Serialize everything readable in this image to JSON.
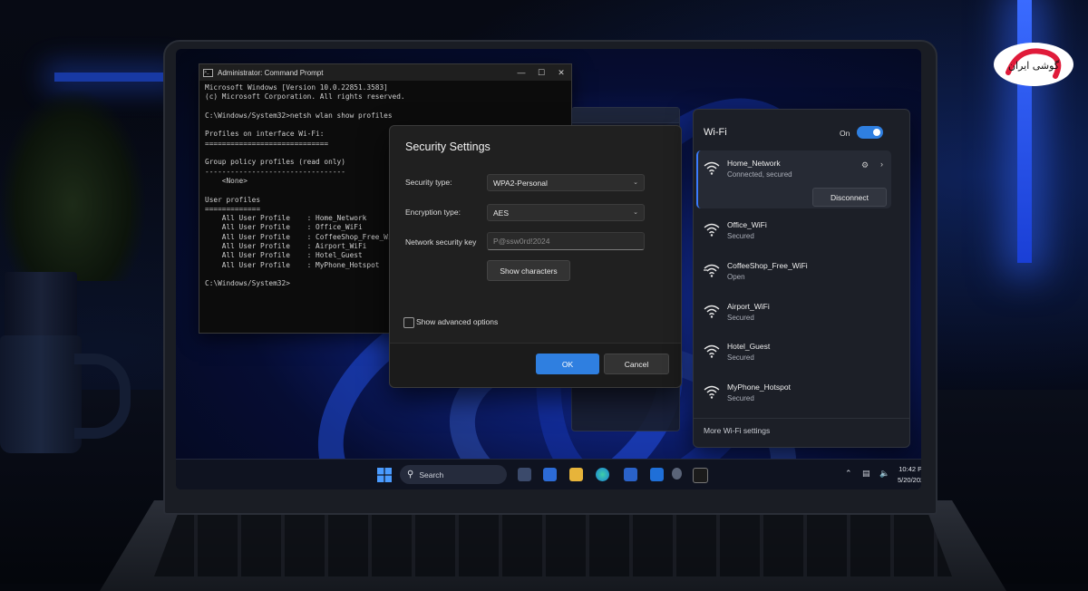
{
  "cmd": {
    "title": "Administrator: Command Prompt",
    "controls": {
      "minimize": "—",
      "maximize": "☐",
      "close": "✕"
    },
    "output": "Microsoft Windows [Version 10.0.22851.3583]\n(c) Microsoft Corporation. All rights reserved.\n\nC:\\Windows/System32>netsh wlan show profiles\n\nProfiles on interface Wi-Fi:\n=============================\n\nGroup policy profiles (read only)\n---------------------------------\n    <None>\n\nUser profiles\n=============\n    All User Profile    : Home_Network\n    All User Profile    : Office_WiFi\n    All User Profile    : CoffeeShop_Free_WiFi\n    All User Profile    : Airport_WiFi\n    All User Profile    : Hotel_Guest\n    All User Profile    : MyPhone_Hotspot\n\nC:\\Windows/System32>"
  },
  "dialog": {
    "title": "Security Settings",
    "security_type_label": "Security type:",
    "security_type_value": "WPA2-Personal",
    "encryption_type_label": "Encryption type:",
    "encryption_type_value": "AES",
    "key_label": "Network security key",
    "key_value": "P@ssw0rd!2024",
    "show_characters": "Show characters",
    "show_advanced": "Show advanced options",
    "ok": "OK",
    "cancel": "Cancel"
  },
  "wifi": {
    "title": "Wi-Fi",
    "toggle_label": "On",
    "disconnect": "Disconnect",
    "more_settings": "More Wi-Fi settings",
    "networks": [
      {
        "name": "Home_Network",
        "status": "Connected, secured"
      },
      {
        "name": "Office_WiFi",
        "status": "Secured"
      },
      {
        "name": "CoffeeShop_Free_WiFi",
        "status": "Open"
      },
      {
        "name": "Airport_WiFi",
        "status": "Secured"
      },
      {
        "name": "Hotel_Guest",
        "status": "Secured"
      },
      {
        "name": "MyPhone_Hotspot",
        "status": "Secured"
      }
    ]
  },
  "taskbar": {
    "search": "Search",
    "time": "10:42 PM",
    "date": "5/20/2024"
  },
  "logo": {
    "text": "گوشی ایران"
  },
  "colors": {
    "accent": "#2f7fe0",
    "dialog_bg": "#202020",
    "flyout_bg": "#1c1f27"
  }
}
